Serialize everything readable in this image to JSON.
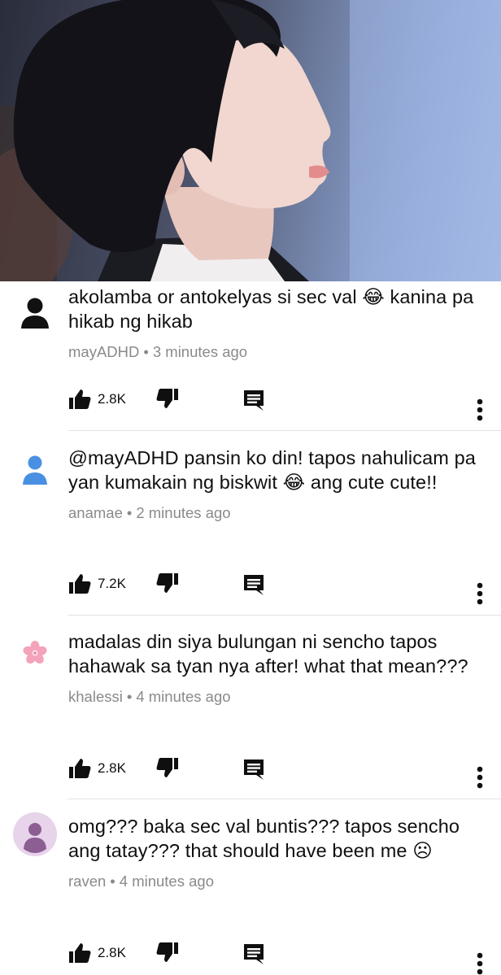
{
  "colors": {
    "text": "#0f0f0f",
    "meta": "#8a8a8a",
    "avatar_black": "#111111",
    "avatar_blue": "#4a90e2",
    "avatar_pink": "#f4a3bb",
    "avatar_purple_bg": "#e7d3ea",
    "avatar_purple_fg": "#8c5e93"
  },
  "comments": [
    {
      "avatar": "person-silhouette-black-icon",
      "text": "akolamba or antokelyas si sec val 😂 kanina pa hikab ng hikab",
      "author": "mayADHD",
      "separator": "•",
      "time": "3 minutes ago",
      "likes": "2.8K"
    },
    {
      "avatar": "person-silhouette-blue-icon",
      "text": "@mayADHD pansin ko din! tapos nahulicam pa yan kumakain ng biskwit 😂 ang cute cute!!",
      "author": "anamae",
      "separator": "•",
      "time": "2 minutes ago",
      "likes": "7.2K"
    },
    {
      "avatar": "cherry-blossom-icon",
      "text": "madalas din siya bulungan ni sencho tapos hahawak sa tyan nya after! what that mean???",
      "author": "khalessi",
      "separator": "•",
      "time": "4 minutes ago",
      "likes": "2.8K"
    },
    {
      "avatar": "person-circle-purple-icon",
      "text": "omg??? baka sec val buntis??? tapos sencho ang tatay??? that should have been me ☹",
      "author": "raven",
      "separator": "•",
      "time": "4 minutes ago",
      "likes": "2.8K"
    }
  ]
}
